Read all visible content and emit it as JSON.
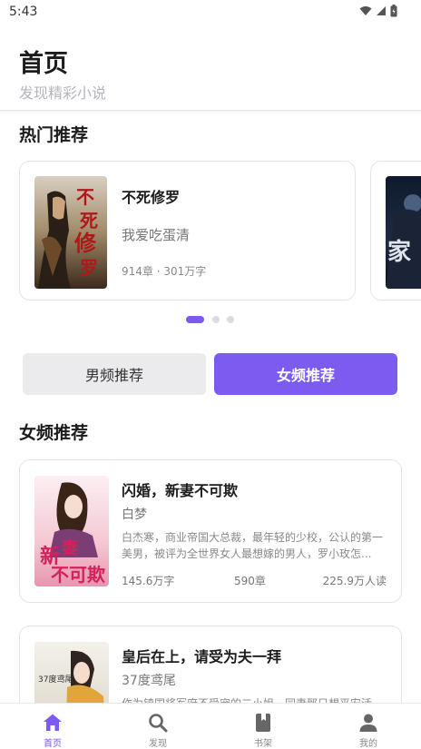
{
  "status_bar": {
    "time": "5:43"
  },
  "header": {
    "title": "首页",
    "subtitle": "发现精彩小说"
  },
  "hot_section": {
    "title": "热门推荐",
    "books": [
      {
        "title": "不死修罗",
        "author": "我爱吃蛋清",
        "meta": "914章 · 301万字",
        "cover_text": "不死修罗"
      },
      {
        "cover_text": "家"
      }
    ],
    "active_page": 1,
    "page_count": 3
  },
  "category_toggle": {
    "male_label": "男频推荐",
    "female_label": "女频推荐",
    "selected": "female"
  },
  "female_section": {
    "title": "女频推荐",
    "books": [
      {
        "title": "闪婚，新妻不可欺",
        "author": "白梦",
        "description": "白杰寒，商业帝国大总裁，最年轻的少校，公认的第一美男，被评为全世界女人最想嫁的男人，罗小玫怎...",
        "words": "145.6万字",
        "chapters": "590章",
        "reads": "225.9万人读",
        "cover_text": "新妻不可欺"
      },
      {
        "title": "皇后在上，请受为夫一拜",
        "author": "37度鸢尾",
        "description": "作为镇国将军府不受宠的二小姐，同妻郅只想平安活...",
        "cover_text": "37度鸢尾"
      }
    ]
  },
  "bottom_nav": {
    "items": [
      {
        "label": "首页",
        "icon": "home-icon"
      },
      {
        "label": "发现",
        "icon": "search-icon"
      },
      {
        "label": "书架",
        "icon": "bookshelf-icon"
      },
      {
        "label": "我的",
        "icon": "profile-icon"
      }
    ],
    "active_index": 0
  },
  "colors": {
    "accent": "#7c5cf0",
    "text_primary": "#1c1c1e",
    "text_secondary": "#777777",
    "subtitle": "#b4b4bc"
  }
}
